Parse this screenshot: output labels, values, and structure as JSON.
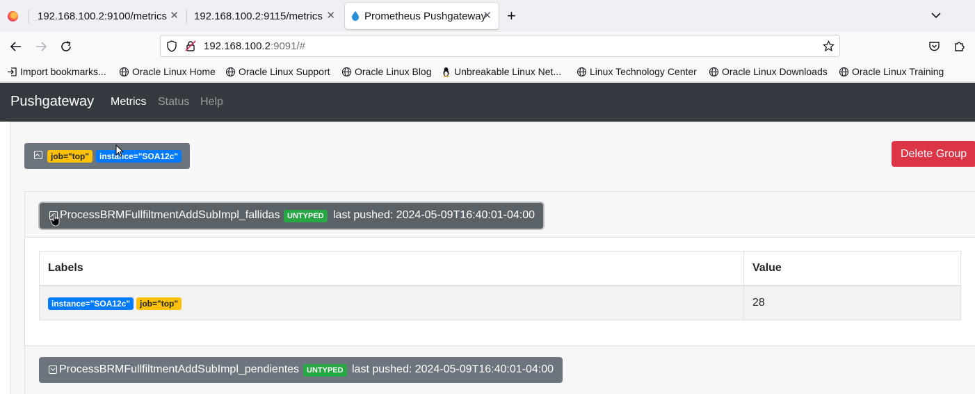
{
  "browser": {
    "tabs": [
      {
        "title": "192.168.100.2:9100/metrics",
        "active": false
      },
      {
        "title": "192.168.100.2:9115/metrics",
        "active": false
      },
      {
        "title": "Prometheus Pushgateway",
        "active": true
      }
    ],
    "url": {
      "host": "192.168.100.2",
      "rest": ":9091/#"
    },
    "bookmarks": [
      {
        "label": "Import bookmarks...",
        "icon": "import-icon"
      },
      {
        "label": "Oracle Linux Home",
        "icon": "globe-icon"
      },
      {
        "label": "Oracle Linux Support",
        "icon": "globe-icon"
      },
      {
        "label": "Oracle Linux Blog",
        "icon": "globe-icon"
      },
      {
        "label": "Unbreakable Linux Net...",
        "icon": "tux-icon"
      },
      {
        "label": "Linux Technology Center",
        "icon": "globe-icon"
      },
      {
        "label": "Oracle Linux Downloads",
        "icon": "globe-icon"
      },
      {
        "label": "Oracle Linux Training",
        "icon": "globe-icon"
      }
    ]
  },
  "app": {
    "brand": "Pushgateway",
    "nav": [
      {
        "label": "Metrics",
        "active": true
      },
      {
        "label": "Status",
        "active": false
      },
      {
        "label": "Help",
        "active": false
      }
    ]
  },
  "group": {
    "labels": [
      "job=\"top\"",
      "instance=\"SOA12c\""
    ],
    "delete_label": "Delete Group",
    "metrics": [
      {
        "name": "ProcessBRMFullfiltmentAddSubImpl_fallidas",
        "type": "UNTYPED",
        "last_pushed": "last pushed: 2024-05-09T16:40:01-04:00",
        "expanded": true,
        "table": {
          "headers": [
            "Labels",
            "Value"
          ],
          "rows": [
            {
              "labels": [
                "instance=\"SOA12c\"",
                "job=\"top\""
              ],
              "value": "28"
            }
          ]
        }
      },
      {
        "name": "ProcessBRMFullfiltmentAddSubImpl_pendientes",
        "type": "UNTYPED",
        "last_pushed": "last pushed: 2024-05-09T16:40:01-04:00",
        "expanded": false
      }
    ]
  },
  "colors": {
    "navbar": "#343a40",
    "job_badge": "#ffc107",
    "instance_badge": "#007bff",
    "untyped_badge": "#28a745",
    "delete_button": "#dc3545",
    "header_button": "#6c757d"
  }
}
